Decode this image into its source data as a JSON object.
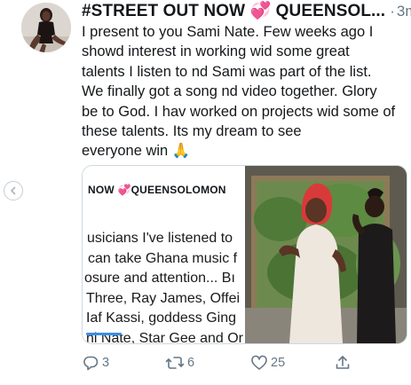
{
  "tweet": {
    "title": "#STREET OUT NOW 💞 QUEENSOL...",
    "separator": "·",
    "time": "3m",
    "more": "•••",
    "lines": [
      "I present to you Sami Nate. Few weeks ago I",
      "showd interest in working wid some great",
      "talents I listen to nd Sami was part of the list.",
      "We finally got a song nd video together. Glory",
      "be to God. I hav worked on projects wid some of",
      "these talents. Its my dream to see",
      "everyone win 🙏"
    ]
  },
  "card": {
    "heading": "NOW 💞QUEENSOLOMON",
    "lines": [
      "usicians I've listened to",
      "can take Ghana music f",
      "osure and attention... Bı",
      "Three, Ray James, Offei",
      "Iaf Kassi, goddess Ging",
      "ni Nate, Star Gee and Or"
    ]
  },
  "actions": {
    "reply_count": "3",
    "retweet_count": "6",
    "like_count": "25"
  },
  "colors": {
    "accent": "#3a8ee6",
    "muted": "#657786",
    "pink_heart": "#e0245e"
  }
}
